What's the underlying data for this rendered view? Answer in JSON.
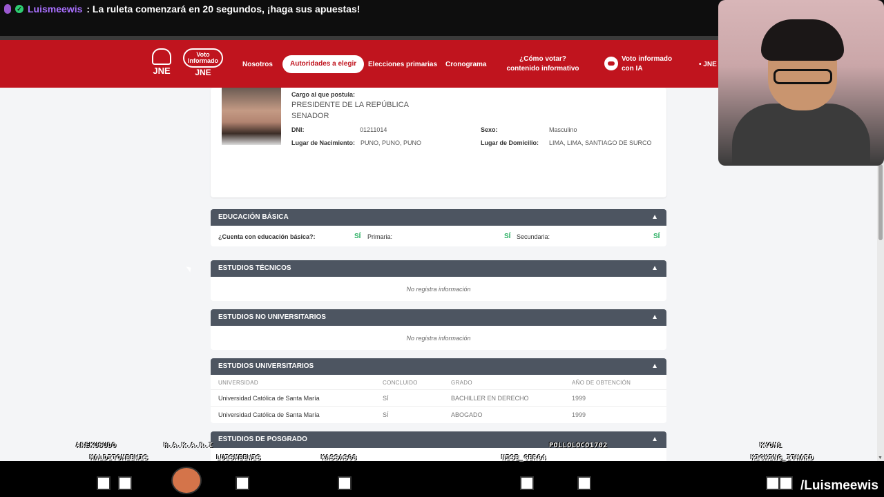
{
  "stream": {
    "chat_user": "Luismeewis",
    "chat_message": ": La ruleta comenzará en 20 segundos, ¡haga sus apuestas!",
    "handle": "/Luismeewis",
    "viewers": [
      "AREKUSUDO",
      "H.A.K.A.R.I",
      "MALDITOMEEWIS",
      "LUISMEEWIS",
      "KASSAS08",
      "NISE_CER04",
      "POLLOLOCO1702",
      "KYOM1",
      "KICKING_ITHARD"
    ]
  },
  "header": {
    "logo_text": "JNE",
    "logo2_top": "Voto",
    "logo2_mid": "Informado",
    "logo2_bottom": "JNE",
    "nav": {
      "nosotros": "Nosotros",
      "autoridades": "Autoridades a elegir",
      "primarias": "Elecciones primarias",
      "cronograma": "Cronograma",
      "como_votar": "¿Cómo votar? contenido informativo",
      "voto_ia": "Voto informado con IA",
      "jne": "• JNE"
    }
  },
  "profile": {
    "cargo_label": "Cargo al que postula:",
    "cargo_1": "PRESIDENTE DE LA REPÚBLICA",
    "cargo_2": "SENADOR",
    "dni_label": "DNI:",
    "dni_value": "01211014",
    "sexo_label": "Sexo:",
    "sexo_value": "Masculino",
    "nacimiento_label": "Lugar de Nacimiento:",
    "nacimiento_value": "PUNO, PUNO, PUNO",
    "domicilio_label": "Lugar de Domicilio:",
    "domicilio_value": "LIMA, LIMA, SANTIAGO DE SURCO"
  },
  "sections": {
    "basica": {
      "title": "EDUCACIÓN BÁSICA",
      "q1": "¿Cuenta con educación básica?:",
      "a1": "SÍ",
      "q2": "Primaria:",
      "a2": "SÍ",
      "q3": "Secundaria:",
      "a3": "SÍ"
    },
    "tecnicos": {
      "title": "ESTUDIOS TÉCNICOS",
      "empty": "No registra información"
    },
    "no_univ": {
      "title": "ESTUDIOS NO UNIVERSITARIOS",
      "empty": "No registra información"
    },
    "univ": {
      "title": "ESTUDIOS UNIVERSITARIOS",
      "headers": [
        "UNIVERSIDAD",
        "CONCLUIDO",
        "GRADO",
        "AÑO DE OBTENCIÓN"
      ],
      "rows": [
        [
          "Universidad Católica de Santa María",
          "SÍ",
          "BACHILLER EN DERECHO",
          "1999"
        ],
        [
          "Universidad Católica de Santa María",
          "SÍ",
          "ABOGADO",
          "1999"
        ]
      ]
    },
    "posgrado": {
      "title": "ESTUDIOS DE POSGRADO"
    }
  },
  "icons": {
    "chevron": "▲"
  }
}
